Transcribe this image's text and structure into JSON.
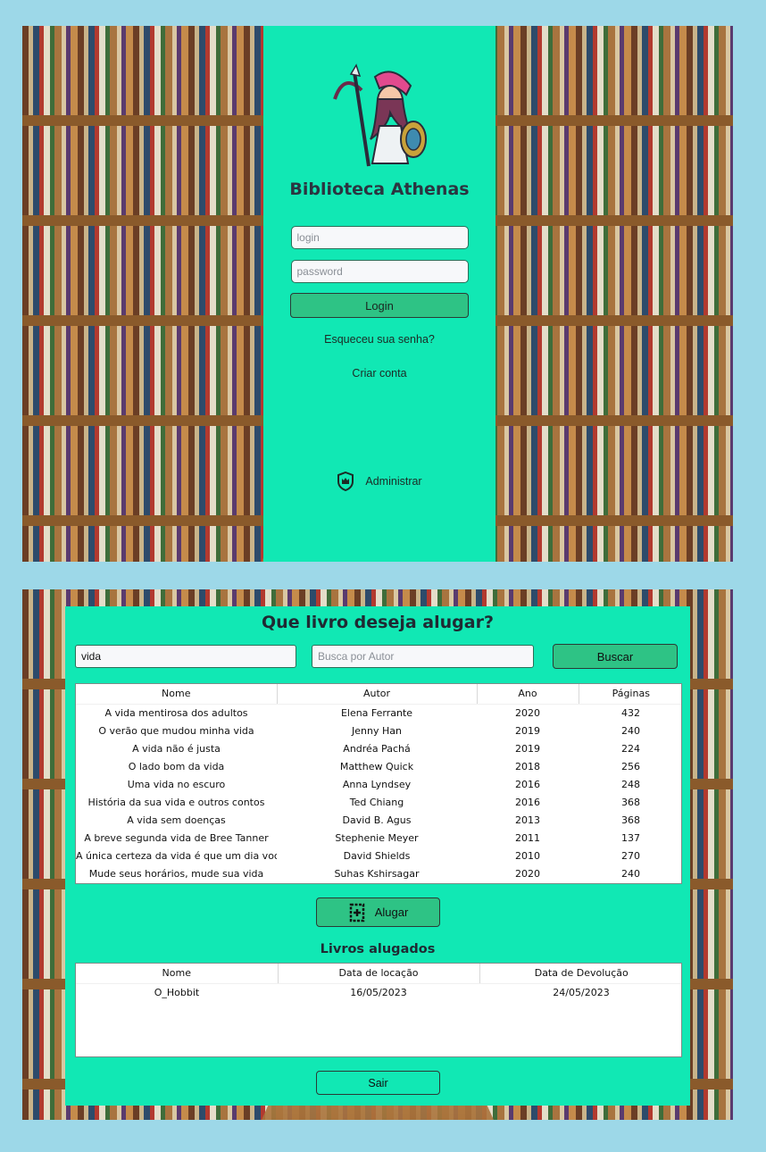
{
  "login": {
    "brand": "Biblioteca Athenas",
    "login_placeholder": "login",
    "password_placeholder": "password",
    "login_button": "Login",
    "forgot_link": "Esqueceu sua senha?",
    "create_link": "Criar conta",
    "admin_label": "Administrar",
    "logo_icon": "athena-warrior-logo-icon",
    "admin_icon": "shield-crown-icon"
  },
  "rent": {
    "title": "Que livro deseja alugar?",
    "title_search_value": "vida",
    "author_search_placeholder": "Busca por Autor",
    "search_button": "Buscar",
    "columns": [
      "Nome",
      "Autor",
      "Ano",
      "Páginas"
    ],
    "books": [
      [
        "A vida mentirosa dos adultos",
        "Elena Ferrante",
        "2020",
        "432"
      ],
      [
        "O verão que mudou minha vida",
        "Jenny Han",
        "2019",
        "240"
      ],
      [
        "A vida não é justa",
        "Andréa Pachá",
        "2019",
        "224"
      ],
      [
        "O lado bom da vida",
        "Matthew Quick",
        "2018",
        "256"
      ],
      [
        "Uma vida no escuro",
        "Anna Lyndsey",
        "2016",
        "248"
      ],
      [
        "História da sua vida e outros contos",
        "Ted Chiang",
        "2016",
        "368"
      ],
      [
        "A vida sem doenças",
        "David B. Agus",
        "2013",
        "368"
      ],
      [
        "A breve segunda vida de Bree Tanner",
        "Stephenie Meyer",
        "2011",
        "137"
      ],
      [
        "A única certeza da vida é que um dia você",
        "David Shields",
        "2010",
        "270"
      ],
      [
        "Mude seus horários, mude sua vida",
        "Suhas Kshirsagar",
        "2020",
        "240"
      ]
    ],
    "rent_button": "Alugar",
    "rent_icon": "book-add-icon",
    "rented_title": "Livros alugados",
    "rented_columns": [
      "Nome",
      "Data de locação",
      "Data de Devolução"
    ],
    "rented": [
      [
        "O_Hobbit",
        "16/05/2023",
        "24/05/2023"
      ]
    ],
    "exit_button": "Sair"
  },
  "colors": {
    "panel": "#11e8b4",
    "button": "#2ec385",
    "page_bg": "#9dd8e8"
  }
}
